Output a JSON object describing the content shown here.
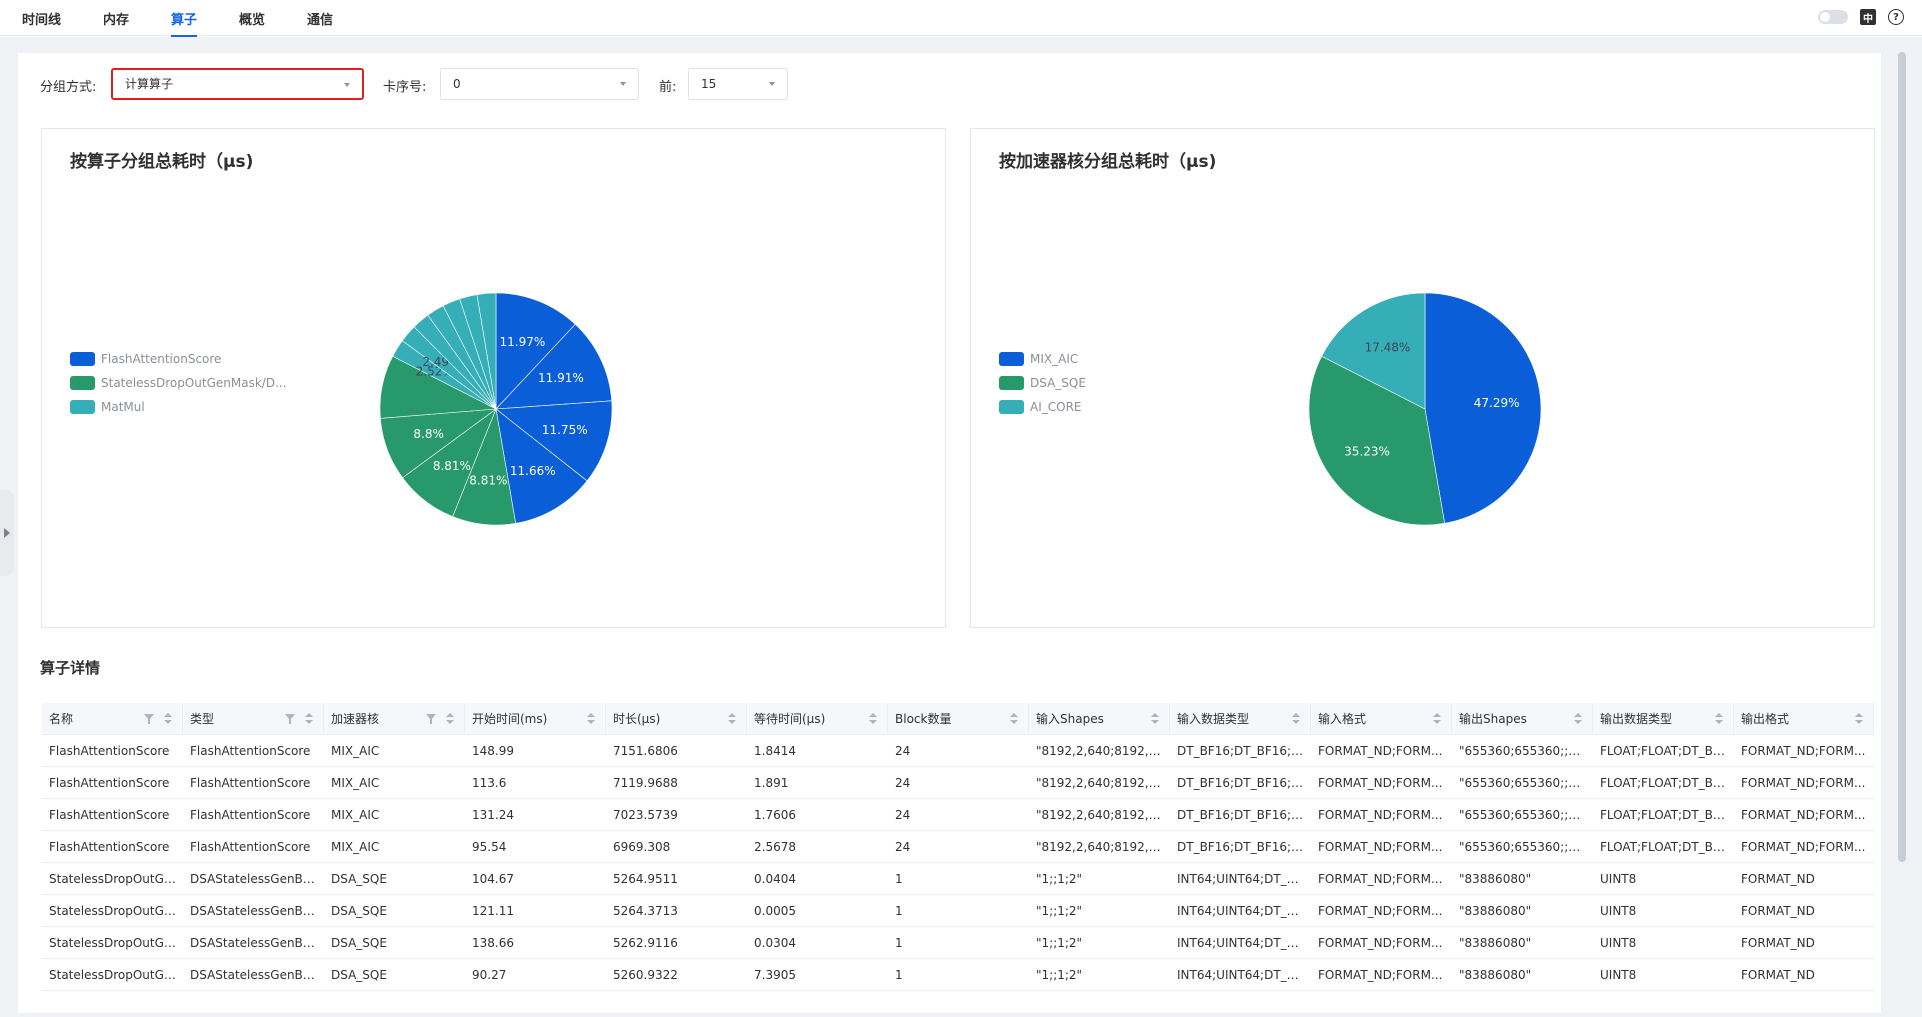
{
  "nav": {
    "tabs": [
      {
        "label": "时间线"
      },
      {
        "label": "内存"
      },
      {
        "label": "算子"
      },
      {
        "label": "概览"
      },
      {
        "label": "通信"
      }
    ],
    "active_tab": "算子",
    "lang_icon_text": "中",
    "help_icon_text": "?"
  },
  "filters": {
    "group_label": "分组方式:",
    "group_value": "计算算子",
    "card_label": "卡序号:",
    "card_value": "0",
    "top_label": "前:",
    "top_value": "15"
  },
  "charts": {
    "left_title": "按算子分组总耗时（μs)",
    "right_title": "按加速器核分组总耗时（μs)"
  },
  "chart_data": [
    {
      "type": "pie",
      "title": "按算子分组总耗时（μs)",
      "legend": [
        "FlashAttentionScore",
        "StatelessDropOutGenMask/D...",
        "MatMul"
      ],
      "colors": [
        "#0a5fd8",
        "#27996b",
        "#35aeb8"
      ],
      "slices": [
        {
          "group": 0,
          "value": 11.97,
          "label": "11.97%"
        },
        {
          "group": 0,
          "value": 11.91,
          "label": "11.91%"
        },
        {
          "group": 0,
          "value": 11.75,
          "label": "11.75%"
        },
        {
          "group": 0,
          "value": 11.66,
          "label": "11.66%"
        },
        {
          "group": 1,
          "value": 8.81,
          "label": "8.81%"
        },
        {
          "group": 1,
          "value": 8.81,
          "label": "8.81%"
        },
        {
          "group": 1,
          "value": 8.8,
          "label": "8.8%"
        },
        {
          "group": 1,
          "value": 8.8,
          "label": ""
        },
        {
          "group": 2,
          "value": 2.52,
          "label": "2.52%"
        },
        {
          "group": 2,
          "value": 2.49,
          "label": "2.49%"
        },
        {
          "group": 2,
          "value": 2.48,
          "label": ""
        },
        {
          "group": 2,
          "value": 2.47,
          "label": ""
        },
        {
          "group": 2,
          "value": 2.46,
          "label": ""
        },
        {
          "group": 2,
          "value": 2.45,
          "label": ""
        },
        {
          "group": 2,
          "value": 2.62,
          "label": ""
        }
      ]
    },
    {
      "type": "pie",
      "title": "按加速器核分组总耗时（μs)",
      "legend": [
        "MIX_AIC",
        "DSA_SQE",
        "AI_CORE"
      ],
      "colors": [
        "#0a5fd8",
        "#27996b",
        "#35aeb8"
      ],
      "slices": [
        {
          "group": 0,
          "value": 47.29,
          "label": "47.29%"
        },
        {
          "group": 1,
          "value": 35.23,
          "label": "35.23%"
        },
        {
          "group": 2,
          "value": 17.48,
          "label": "17.48%"
        }
      ]
    }
  ],
  "table": {
    "title": "算子详情",
    "columns": [
      "名称",
      "类型",
      "加速器核",
      "开始时间(ms)",
      "时长(μs)",
      "等待时间(μs)",
      "Block数量",
      "输入Shapes",
      "输入数据类型",
      "输入格式",
      "输出Shapes",
      "输出数据类型",
      "输出格式"
    ],
    "rows": [
      [
        "FlashAttentionScore",
        "FlashAttentionScore",
        "MIX_AIC",
        "148.99",
        "7151.6806",
        "1.8414",
        "24",
        "\"8192,2,640;8192,2,...",
        "DT_BF16;DT_BF16;D...",
        "FORMAT_ND;FORM...",
        "\"655360;655360;;10...",
        "FLOAT;FLOAT;DT_BF...",
        "FORMAT_ND;FORM..."
      ],
      [
        "FlashAttentionScore",
        "FlashAttentionScore",
        "MIX_AIC",
        "113.6",
        "7119.9688",
        "1.891",
        "24",
        "\"8192,2,640;8192,2,...",
        "DT_BF16;DT_BF16;D...",
        "FORMAT_ND;FORM...",
        "\"655360;655360;;10...",
        "FLOAT;FLOAT;DT_BF...",
        "FORMAT_ND;FORM..."
      ],
      [
        "FlashAttentionScore",
        "FlashAttentionScore",
        "MIX_AIC",
        "131.24",
        "7023.5739",
        "1.7606",
        "24",
        "\"8192,2,640;8192,2,...",
        "DT_BF16;DT_BF16;D...",
        "FORMAT_ND;FORM...",
        "\"655360;655360;;10...",
        "FLOAT;FLOAT;DT_BF...",
        "FORMAT_ND;FORM..."
      ],
      [
        "FlashAttentionScore",
        "FlashAttentionScore",
        "MIX_AIC",
        "95.54",
        "6969.308",
        "2.5678",
        "24",
        "\"8192,2,640;8192,2,...",
        "DT_BF16;DT_BF16;D...",
        "FORMAT_ND;FORM...",
        "\"655360;655360;;10...",
        "FLOAT;FLOAT;DT_BF...",
        "FORMAT_ND;FORM..."
      ],
      [
        "StatelessDropOutGe...",
        "DSAStatelessGenBit...",
        "DSA_SQE",
        "104.67",
        "5264.9511",
        "0.0404",
        "1",
        "\"1;;1;2\"",
        "INT64;UINT64;DT_B...",
        "FORMAT_ND;FORM...",
        "\"83886080\"",
        "UINT8",
        "FORMAT_ND"
      ],
      [
        "StatelessDropOutGe...",
        "DSAStatelessGenBit...",
        "DSA_SQE",
        "121.11",
        "5264.3713",
        "0.0005",
        "1",
        "\"1;;1;2\"",
        "INT64;UINT64;DT_B...",
        "FORMAT_ND;FORM...",
        "\"83886080\"",
        "UINT8",
        "FORMAT_ND"
      ],
      [
        "StatelessDropOutGe...",
        "DSAStatelessGenBit...",
        "DSA_SQE",
        "138.66",
        "5262.9116",
        "0.0304",
        "1",
        "\"1;;1;2\"",
        "INT64;UINT64;DT_B...",
        "FORMAT_ND;FORM...",
        "\"83886080\"",
        "UINT8",
        "FORMAT_ND"
      ],
      [
        "StatelessDropOutGe...",
        "DSAStatelessGenBit...",
        "DSA_SQE",
        "90.27",
        "5260.9322",
        "7.3905",
        "1",
        "\"1;;1;2\"",
        "INT64;UINT64;DT_B...",
        "FORMAT_ND;FORM...",
        "\"83886080\"",
        "UINT8",
        "FORMAT_ND"
      ]
    ]
  }
}
